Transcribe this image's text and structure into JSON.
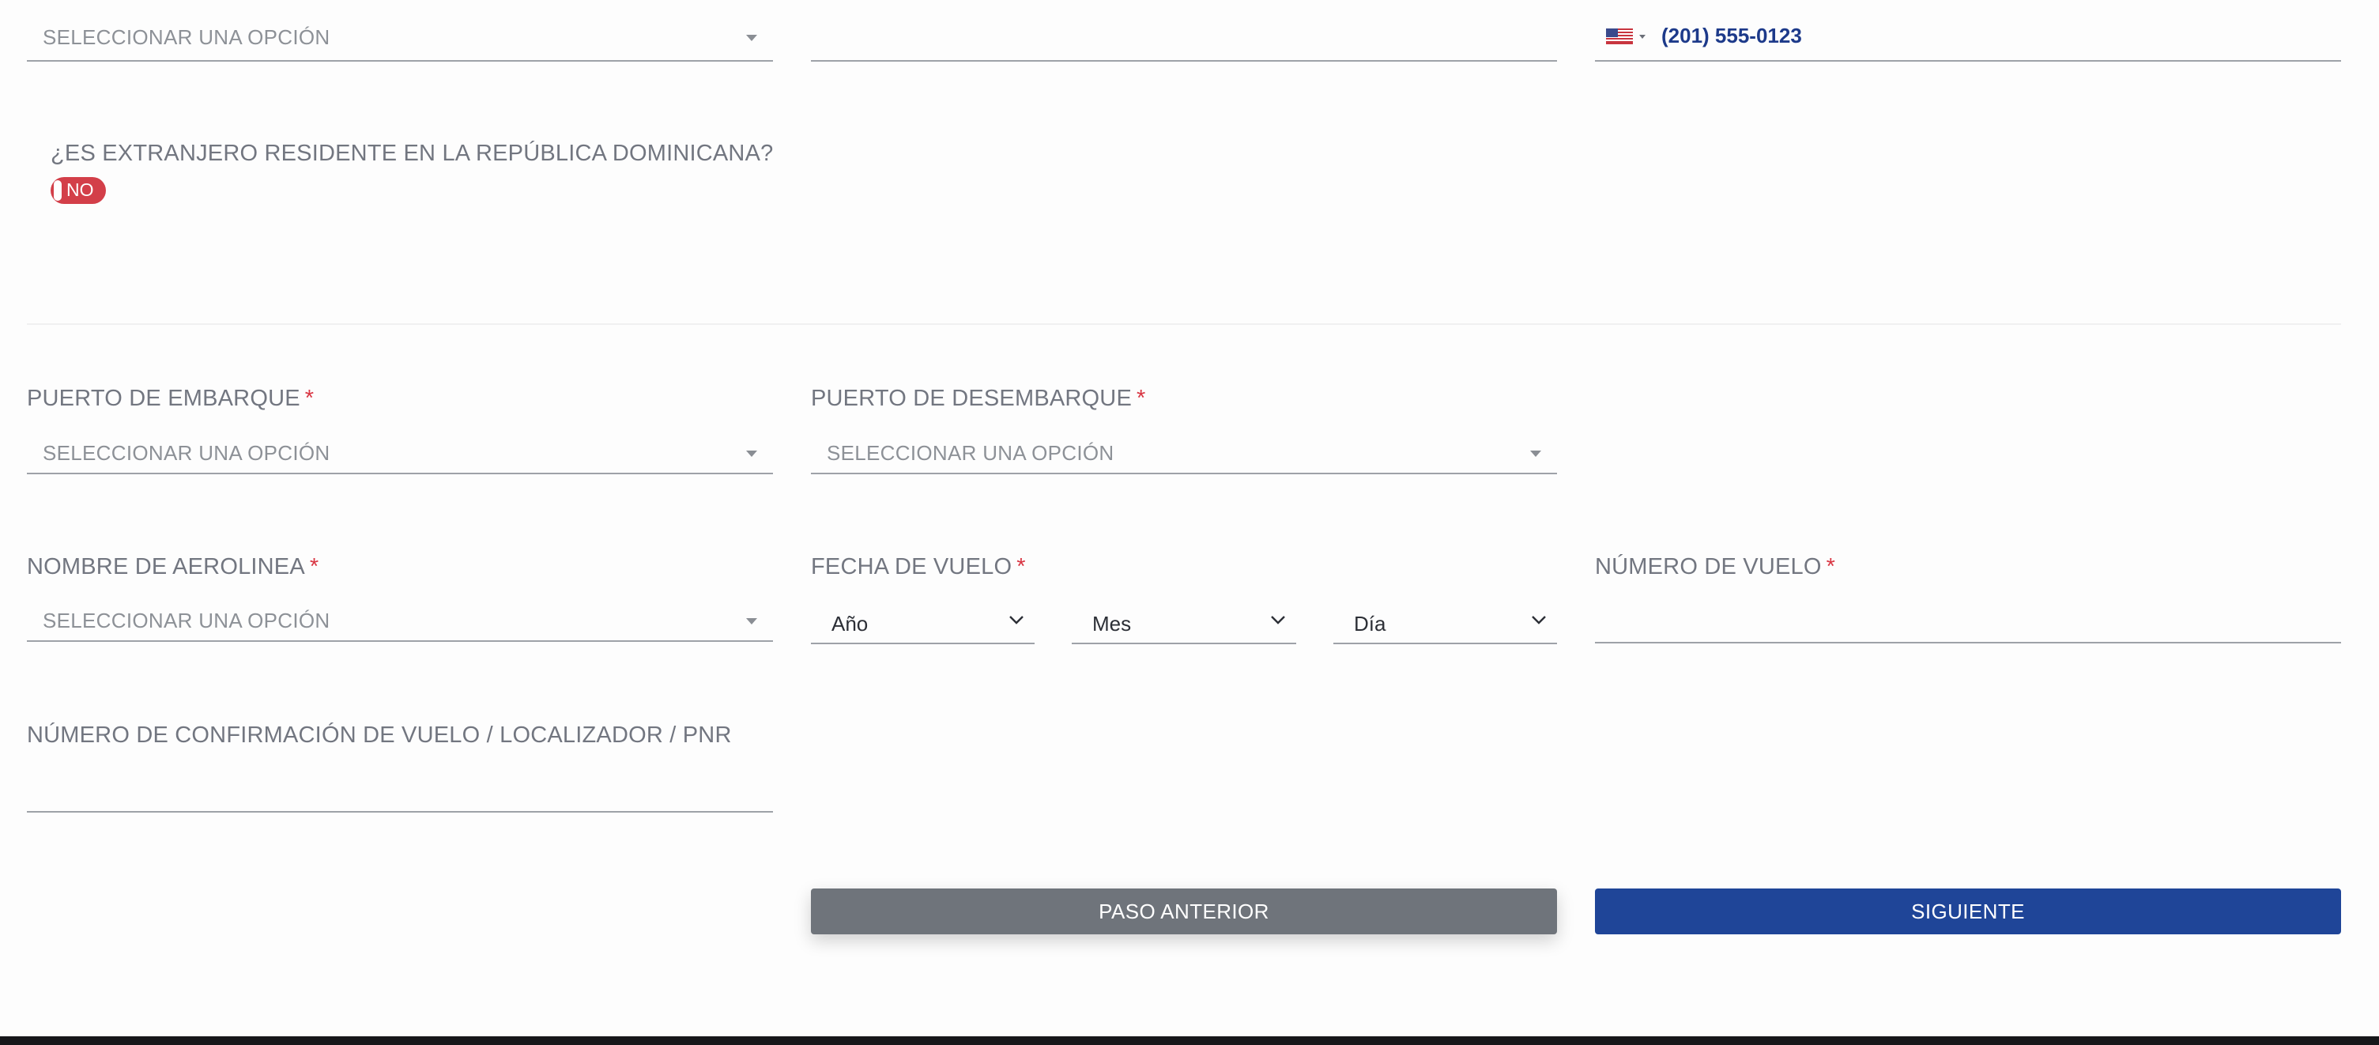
{
  "top_row": {
    "select_placeholder": "SELECCIONAR UNA OPCIÓN",
    "phone_value": "(201) 555-0123",
    "phone_flag_icon": "us-flag-icon"
  },
  "resident": {
    "question": "¿ES EXTRANJERO RESIDENTE EN LA REPÚBLICA DOMINICANA?",
    "toggle_label": "NO",
    "toggle_color": "#d33f49"
  },
  "embarkation": {
    "label": "PUERTO DE EMBARQUE",
    "required": "*",
    "placeholder": "SELECCIONAR UNA OPCIÓN"
  },
  "disembarkation": {
    "label": "PUERTO DE DESEMBARQUE",
    "required": "*",
    "placeholder": "SELECCIONAR UNA OPCIÓN"
  },
  "airline": {
    "label": "NOMBRE DE AEROLINEA",
    "required": "*",
    "placeholder": "SELECCIONAR UNA OPCIÓN"
  },
  "flight_date": {
    "label": "FECHA DE VUELO",
    "required": "*",
    "year": "Año",
    "month": "Mes",
    "day": "Día"
  },
  "flight_number": {
    "label": "NÚMERO DE VUELO",
    "required": "*"
  },
  "confirmation": {
    "label": "NÚMERO DE CONFIRMACIÓN DE VUELO / LOCALIZADOR / PNR"
  },
  "buttons": {
    "previous": "PASO ANTERIOR",
    "next": "SIGUIENTE",
    "previous_color": "#6f747b",
    "next_color": "#1f4598"
  },
  "colors": {
    "required": "#d93744",
    "phone_text": "#1d3a8a",
    "footer": "#16171a"
  }
}
